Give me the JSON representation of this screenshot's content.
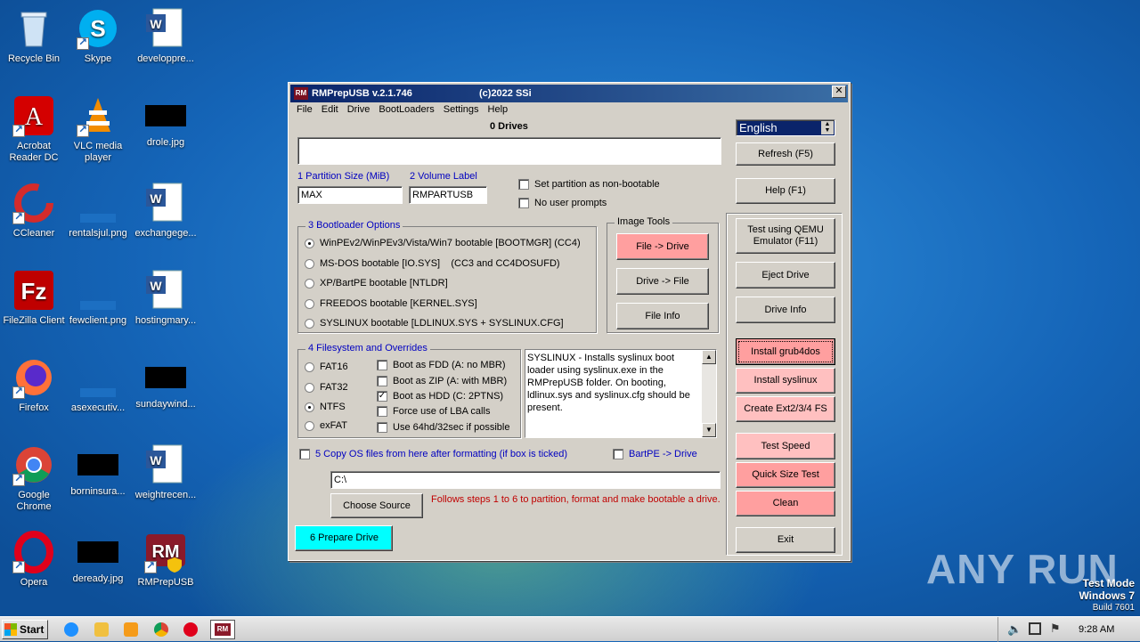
{
  "desktop": {
    "icons": [
      {
        "label": "Recycle Bin"
      },
      {
        "label": "Skype"
      },
      {
        "label": "developpre..."
      },
      {
        "label": "Acrobat Reader DC"
      },
      {
        "label": "VLC media player"
      },
      {
        "label": "drole.jpg"
      },
      {
        "label": "CCleaner"
      },
      {
        "label": "rentalsjul.png"
      },
      {
        "label": "exchangege..."
      },
      {
        "label": "FileZilla Client"
      },
      {
        "label": "fewclient.png"
      },
      {
        "label": "hostingmary..."
      },
      {
        "label": "Firefox"
      },
      {
        "label": "asexecutiv..."
      },
      {
        "label": "sundaywind..."
      },
      {
        "label": "Google Chrome"
      },
      {
        "label": "borninsura..."
      },
      {
        "label": "weightrecen..."
      },
      {
        "label": "Opera"
      },
      {
        "label": "deready.jpg"
      },
      {
        "label": "RMPrepUSB"
      }
    ]
  },
  "window": {
    "app_icon": "RM",
    "title": "RMPrepUSB v.2.1.746",
    "copyright": "(c)2022 SSi",
    "close": "✕",
    "menu": [
      "File",
      "Edit",
      "Drive",
      "BootLoaders",
      "Settings",
      "Help"
    ],
    "drives_label": "0 Drives",
    "language": "English",
    "refresh_button": "Refresh (F5)",
    "help_button": "Help (F1)",
    "partition_size_label": "1 Partition Size (MiB)",
    "partition_size_value": "MAX",
    "volume_label_label": "2 Volume Label",
    "volume_label_value": "RMPARTUSB",
    "non_bootable_label": "Set partition as non-bootable",
    "no_prompts_label": "No user prompts",
    "bootloader_group": "3 Bootloader Options",
    "bootloader_options": [
      "WinPEv2/WinPEv3/Vista/Win7 bootable [BOOTMGR] (CC4)",
      "MS-DOS bootable [IO.SYS]    (CC3 and CC4DOSUFD)",
      "XP/BartPE bootable [NTLDR]",
      "FREEDOS bootable [KERNEL.SYS]",
      "SYSLINUX bootable [LDLINUX.SYS + SYSLINUX.CFG]"
    ],
    "image_tools_group": "Image Tools",
    "file_to_drive": "File -> Drive",
    "drive_to_file": "Drive -> File",
    "file_info": "File Info",
    "test_qemu": "Test using QEMU Emulator (F11)",
    "eject_drive": "Eject Drive",
    "drive_info": "Drive Info",
    "install_grub4dos": "Install grub4dos",
    "install_syslinux": "Install syslinux",
    "create_ext": "Create Ext2/3/4 FS",
    "test_speed": "Test Speed",
    "quick_size_test": "Quick Size Test",
    "clean": "Clean",
    "exit": "Exit",
    "filesystem_group": "4 Filesystem and Overrides",
    "filesystems": [
      "FAT16",
      "FAT32",
      "NTFS",
      "exFAT"
    ],
    "overrides": [
      {
        "label": "Boot as FDD (A: no MBR)",
        "checked": false
      },
      {
        "label": "Boot as ZIP (A: with MBR)",
        "checked": false
      },
      {
        "label": "Boot as HDD (C: 2PTNS)",
        "checked": true
      },
      {
        "label": "Force use of LBA calls",
        "checked": false
      },
      {
        "label": "Use 64hd/32sec if possible",
        "checked": false
      }
    ],
    "info_text": "SYSLINUX - Installs syslinux boot loader using syslinux.exe in the RMPrepUSB folder. On booting, ldlinux.sys and syslinux.cfg should be present.",
    "copy_os_label": "5 Copy OS files from here after formatting (if box is ticked)",
    "bartpe_label": "BartPE -> Drive",
    "source_path": "C:\\",
    "choose_source": "Choose Source",
    "steps_hint": "Follows steps 1 to 6 to partition, format and make bootable a drive.",
    "prepare_drive": "6 Prepare Drive"
  },
  "watermark": "ANY RUN",
  "test_mode": {
    "line1": "Test Mode",
    "line2": "Windows 7",
    "line3": "Build 7601"
  },
  "taskbar": {
    "start": "Start",
    "clock": "9:28 AM"
  }
}
